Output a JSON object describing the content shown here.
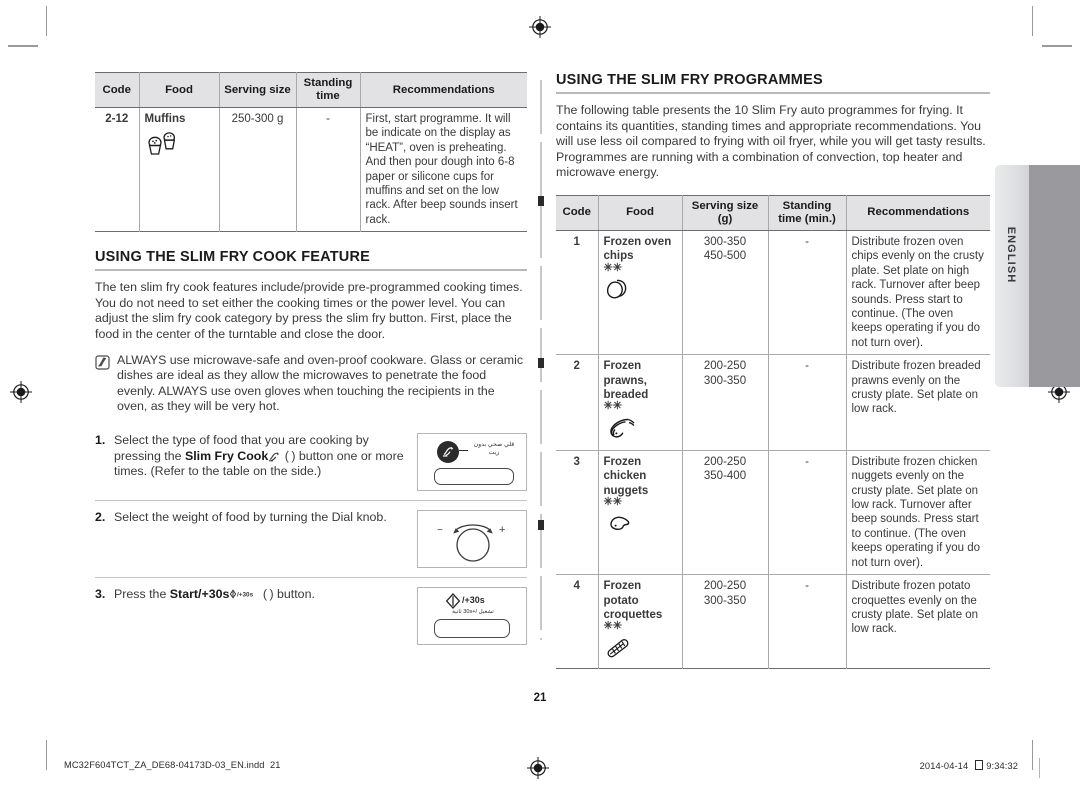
{
  "page": {
    "number": "21",
    "side_tab_label": "ENGLISH"
  },
  "left_column": {
    "top_table": {
      "headers": [
        "Code",
        "Food",
        "Serving size",
        "Standing time",
        "Recommendations"
      ],
      "rows": [
        {
          "code": "2-12",
          "food": "Muffins",
          "food_icon": "muffins-icon",
          "serving_size": [
            "250-300 g"
          ],
          "standing_time": "-",
          "recommendations": "First, start programme. It will be indicate on the display as “HEAT”, oven is preheating. And then pour dough into 6-8 paper or silicone cups for muffins and set on the low rack. After beep sounds insert rack."
        }
      ]
    },
    "section": {
      "heading": "USING THE SLIM FRY COOK FEATURE",
      "paragraph": "The ten slim fry cook features include/provide pre-programmed cooking times. You do not need to set either the cooking times or the power level. You can adjust the slim fry cook category by press the slim fry button. First, place the food in the center of the turntable and close the door.",
      "note": {
        "icon": "note-pencil-icon",
        "text": "ALWAYS use microwave-safe and oven-proof cookware. Glass or ceramic dishes are ideal as they allow the microwaves to penetrate the food evenly. ALWAYS use oven gloves when touching the recipients in the oven, as they will be very hot."
      },
      "steps": [
        {
          "number": "1.",
          "text_before": "Select the type of food that you are cooking by pressing the ",
          "bold": "Slim Fry Cook",
          "text_after": " ( ) button one or more times. (Refer to the table on the side.)",
          "art": "slim-fry-cook-button-illustration",
          "art_caption_ar": "قلي صحي بدون زيت"
        },
        {
          "number": "2.",
          "text_before": "Select the weight of food by turning the Dial knob.",
          "bold": "",
          "text_after": "",
          "art": "dial-knob-illustration",
          "minus": "−",
          "plus": "+"
        },
        {
          "number": "3.",
          "text_before": "Press the ",
          "bold": "Start/+30s",
          "text_after": " ( ) button.",
          "art": "start-30s-button-illustration",
          "art_label": "/+30s",
          "art_caption_ar": "تشغيل /+30s ثانية"
        }
      ]
    }
  },
  "right_column": {
    "section": {
      "heading": "USING THE SLIM FRY PROGRAMMES",
      "paragraph": "The following table presents the 10 Slim Fry auto programmes for frying. It contains its quantities, standing times and appropriate recommendations. You will use less oil compared to frying with oil fryer, while you will get tasty results. Programmes are running with a combination of convection, top heater and microwave energy."
    },
    "table": {
      "headers": [
        "Code",
        "Food",
        "Serving size (g)",
        "Standing time (min.)",
        "Recommendations"
      ],
      "rows": [
        {
          "code": "1",
          "food": [
            "Frozen oven",
            "chips"
          ],
          "food_icon": "frozen-oven-chips-icon",
          "stars": "✳✳",
          "serving_size": [
            "300-350",
            "450-500"
          ],
          "standing_time": "-",
          "recommendations": "Distribute frozen oven chips evenly on the crusty plate. Set plate on high rack. Turnover after beep sounds. Press start to continue. (The oven keeps operating if you do not turn over)."
        },
        {
          "code": "2",
          "food": [
            "Frozen",
            "prawns,",
            "breaded"
          ],
          "food_icon": "frozen-prawns-icon",
          "stars": "✳✳",
          "serving_size": [
            "200-250",
            "300-350"
          ],
          "standing_time": "-",
          "recommendations": "Distribute frozen breaded prawns evenly on the crusty plate. Set plate on low rack."
        },
        {
          "code": "3",
          "food": [
            "Frozen",
            "chicken",
            "nuggets"
          ],
          "food_icon": "frozen-chicken-nuggets-icon",
          "stars": "✳✳",
          "serving_size": [
            "200-250",
            "350-400"
          ],
          "standing_time": "-",
          "recommendations": "Distribute frozen chicken nuggets evenly on the crusty plate. Set plate on low rack. Turnover after beep sounds. Press start to continue. (The oven keeps operating if you do not turn over)."
        },
        {
          "code": "4",
          "food": [
            "Frozen",
            "potato",
            "croquettes"
          ],
          "food_icon": "frozen-potato-croquettes-icon",
          "stars": "✳✳",
          "serving_size": [
            "200-250",
            "300-350"
          ],
          "standing_time": "-",
          "recommendations": "Distribute frozen potato croquettes evenly on the crusty plate. Set plate on low rack."
        }
      ]
    }
  },
  "footer": {
    "file_name": "MC32F604TCT_ZA_DE68-04173D-03_EN.indd",
    "page_ref": "21",
    "date": "2014-04-14",
    "time": "9:34:32"
  }
}
